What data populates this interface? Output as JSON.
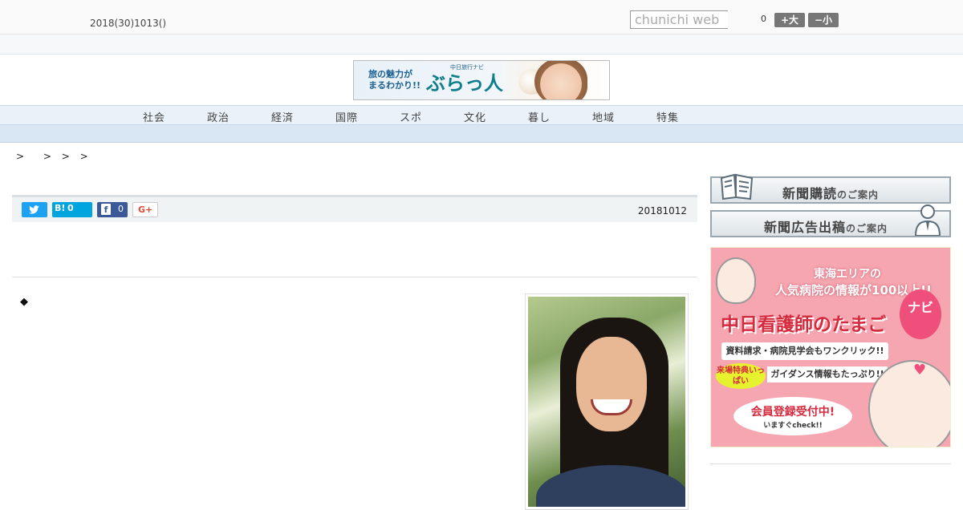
{
  "header": {
    "date": "2018(30)1013()",
    "search_placeholder": "chunichi web",
    "zoom_value": "0",
    "font_bigger": "+大",
    "font_smaller": "−小"
  },
  "banner": {
    "tagline_1": "旅の魅力が",
    "tagline_2": "まるわかり!!",
    "brand": "ぶらっ人",
    "brand_sub": "中日旅行ナビ"
  },
  "nav": {
    "items": [
      "社会",
      "政治",
      "経済",
      "国際",
      "スポ",
      "文化",
      "暮し",
      "地域",
      "特集"
    ]
  },
  "breadcrumb": {
    "items": [
      ">",
      ">",
      ">",
      ">"
    ]
  },
  "share": {
    "twitter_icon": "twitter-icon",
    "hatena_label": "B!",
    "hatena_count": "0",
    "facebook_label": "f",
    "facebook_count": "0",
    "google_label": "G+",
    "date": "20181012"
  },
  "article": {
    "bullet": "◆"
  },
  "sidebar": {
    "subscribe_main": "新聞購読",
    "subscribe_sub": "のご案内",
    "advertise_main": "新聞広告出稿",
    "advertise_sub": "のご案内"
  },
  "ad": {
    "line1": "東海エリアの",
    "line2": "人気病院の情報が100以上!!",
    "title": "中日看護師のたまご",
    "navi": "ナビ",
    "line4": "資料請求・病院見学会もワンクリック!!",
    "tag": "来場特典いっぱい",
    "line5": "ガイダンス情報もたっぷり!!",
    "cta": "会員登録受付中!",
    "cta_sub": "いますぐcheck!!"
  },
  "colors": {
    "nav_bg": "#eaf1f8",
    "twitter": "#1da1f2",
    "hatena": "#00a4de",
    "facebook": "#3b5998",
    "ad_pink": "#f6a6b0",
    "ad_red": "#d5293d"
  }
}
